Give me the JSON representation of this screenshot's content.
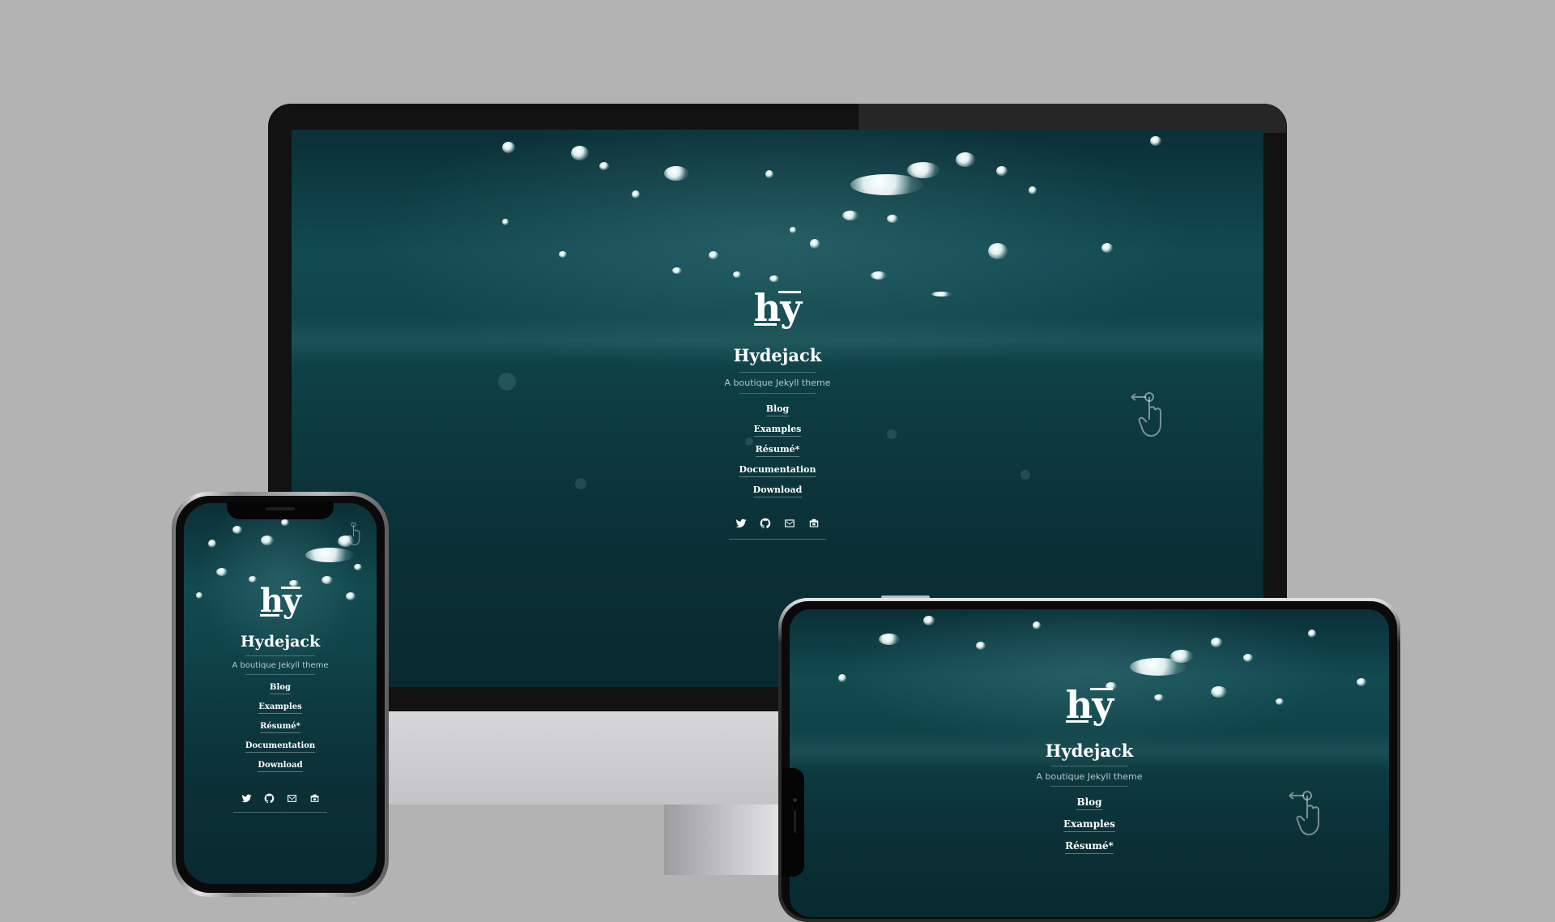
{
  "site": {
    "title": "Hydejack",
    "tagline": "A boutique Jekyll theme",
    "logo_text": "hy"
  },
  "nav": {
    "items": [
      {
        "label": "Blog"
      },
      {
        "label": "Examples"
      },
      {
        "label": "Résumé*"
      },
      {
        "label": "Documentation"
      },
      {
        "label": "Download"
      }
    ]
  },
  "social": {
    "icons": [
      "twitter-icon",
      "github-icon",
      "email-icon",
      "rss-icon"
    ]
  },
  "colors": {
    "background": "#b3b3b3",
    "water_dark": "#082a30",
    "water_mid": "#114a50",
    "text": "#ffffff"
  }
}
